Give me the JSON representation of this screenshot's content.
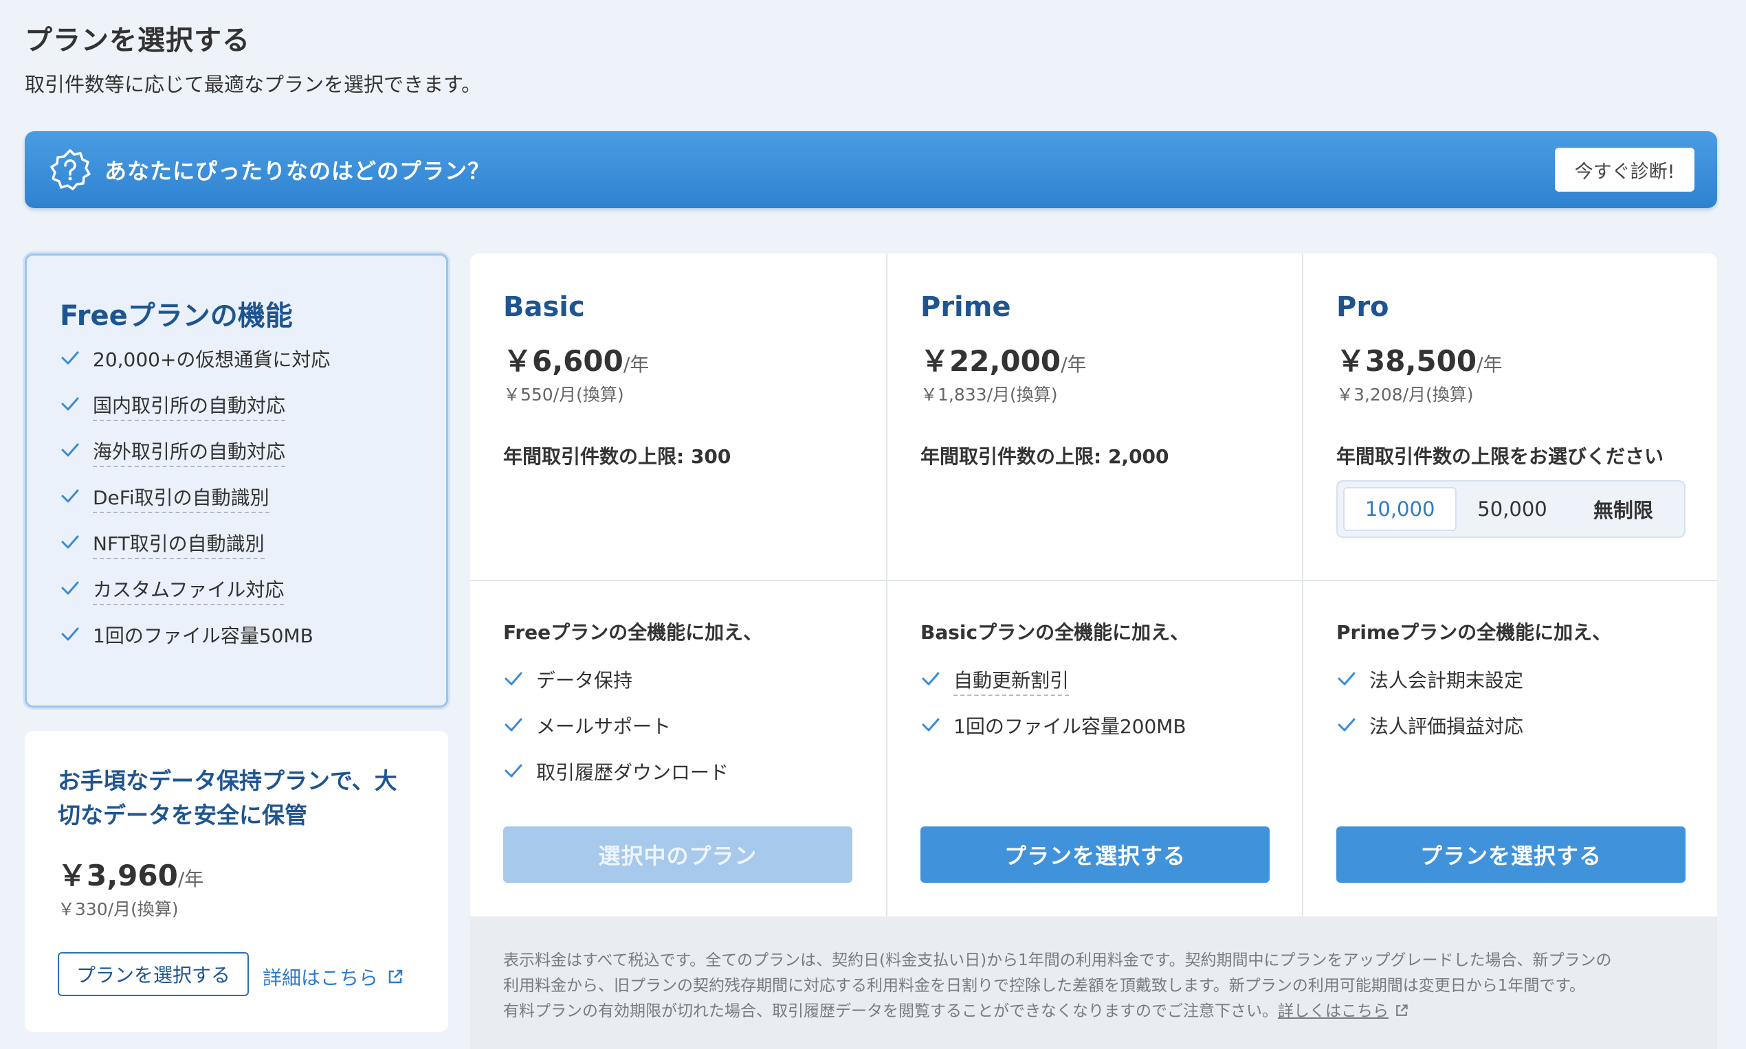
{
  "header": {
    "title": "プランを選択する",
    "subtitle": "取引件数等に応じて最適なプランを選択できます。"
  },
  "banner": {
    "icon": "question-badge-icon",
    "text": "あなたにぴったりなのはどのプラン？",
    "button_label": "今すぐ診断!"
  },
  "free_plan": {
    "title": "Freeプランの機能",
    "features": [
      "20,000+の仮想通貨に対応",
      "国内取引所の自動対応",
      "海外取引所の自動対応",
      "DeFi取引の自動識別",
      "NFT取引の自動識別",
      "カスタムファイル対応",
      "1回のファイル容量50MB"
    ]
  },
  "data_plan": {
    "title": "お手頃なデータ保持プランで、大切なデータを安全に保管",
    "price": "￥3,960",
    "unit": "/年",
    "monthly": "￥330/月(換算)",
    "button_label": "プランを選択する",
    "link_label": "詳細はこちら"
  },
  "plans": [
    {
      "name": "Basic",
      "price": "￥6,600",
      "unit": "/年",
      "monthly": "￥550/月(換算)",
      "limit": "年間取引件数の上限: 300",
      "lead": "Freeプランの全機能に加え、",
      "features": [
        "データ保持",
        "メールサポート",
        "取引履歴ダウンロード"
      ],
      "button_label": "選択中のプラン"
    },
    {
      "name": "Prime",
      "price": "￥22,000",
      "unit": "/年",
      "monthly": "￥1,833/月(換算)",
      "limit": "年間取引件数の上限: 2,000",
      "lead": "Basicプランの全機能に加え、",
      "features": [
        "自動更新割引",
        "1回のファイル容量200MB"
      ],
      "button_label": "プランを選択する"
    },
    {
      "name": "Pro",
      "price": "￥38,500",
      "unit": "/年",
      "monthly": "￥3,208/月(換算)",
      "limit": "年間取引件数の上限をお選びください",
      "options": [
        "10,000",
        "50,000",
        "無制限"
      ],
      "selected_option": "10,000",
      "lead": "Primeプランの全機能に加え、",
      "features": [
        "法人会計期末設定",
        "法人評価損益対応"
      ],
      "button_label": "プランを選択する"
    }
  ],
  "note": {
    "line1": "表示料金はすべて税込です。全てのプランは、契約日(料金支払い日)から1年間の利用料金です。契約期間中にプランをアップグレードした場合、新プランの",
    "line2": "利用料金から、旧プランの契約残存期間に対応する利用料金を日割りで控除した差額を頂戴致します。新プランの利用可能期間は変更日から1年間です。",
    "line3": "有料プランの有効期限が切れた場合、取引履歴データを閲覧することができなくなりますのでご注意下さい。",
    "link_label": "詳しくはこちら"
  },
  "colors": {
    "accent": "#4092db",
    "title_blue": "#1e5591",
    "background": "#eef3fa"
  }
}
